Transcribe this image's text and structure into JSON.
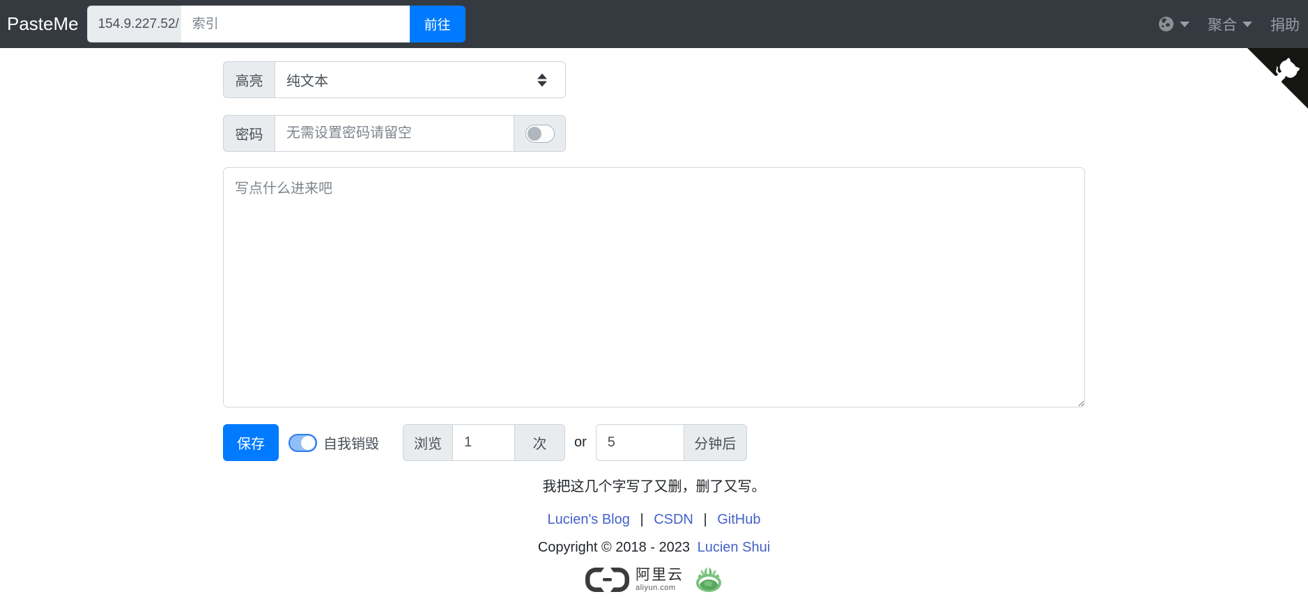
{
  "navbar": {
    "brand": "PasteMe",
    "url_prefix": "154.9.227.52/",
    "search_placeholder": "索引",
    "go_button": "前往",
    "aggregate_label": "聚合",
    "donate_label": "捐助"
  },
  "editor": {
    "highlight_label": "高亮",
    "highlight_selected": "纯文本",
    "password_label": "密码",
    "password_placeholder": "无需设置密码请留空",
    "content_placeholder": "写点什么进来吧",
    "save_button": "保存",
    "self_destruct_label": "自我销毁",
    "views_label": "浏览",
    "views_value": "1",
    "views_unit": "次",
    "or_label": "or",
    "minutes_value": "5",
    "minutes_unit": "分钟后"
  },
  "footer": {
    "motto": "我把这几个字写了又删，删了又写。",
    "links": [
      {
        "label": "Lucien's Blog"
      },
      {
        "label": "CSDN"
      },
      {
        "label": "GitHub"
      }
    ],
    "separator": "|",
    "copyright_text": "Copyright © 2018 - 2023",
    "author_link": "Lucien Shui",
    "aliyun_name": "阿里云",
    "aliyun_domain": "aliyun.com"
  },
  "icons": {
    "globe": "globe-language-icon",
    "caret": "chevron-down-icon",
    "github_corner": "github-octocat-corner",
    "select_arrows": "up-down-arrows-icon",
    "aliyun_logo": "aliyun-brackets-logo",
    "moeicp": "moeicp-green-wreath-icon"
  },
  "colors": {
    "navbar_bg": "#343a40",
    "primary_blue": "#007bff",
    "link_blue": "#4462c9",
    "addon_bg": "#e9ecef",
    "border_gray": "#ced4da",
    "corner_black": "#151513",
    "switch_on_fill": "#8fbef8",
    "switch_on_border": "#2e7cf6"
  }
}
